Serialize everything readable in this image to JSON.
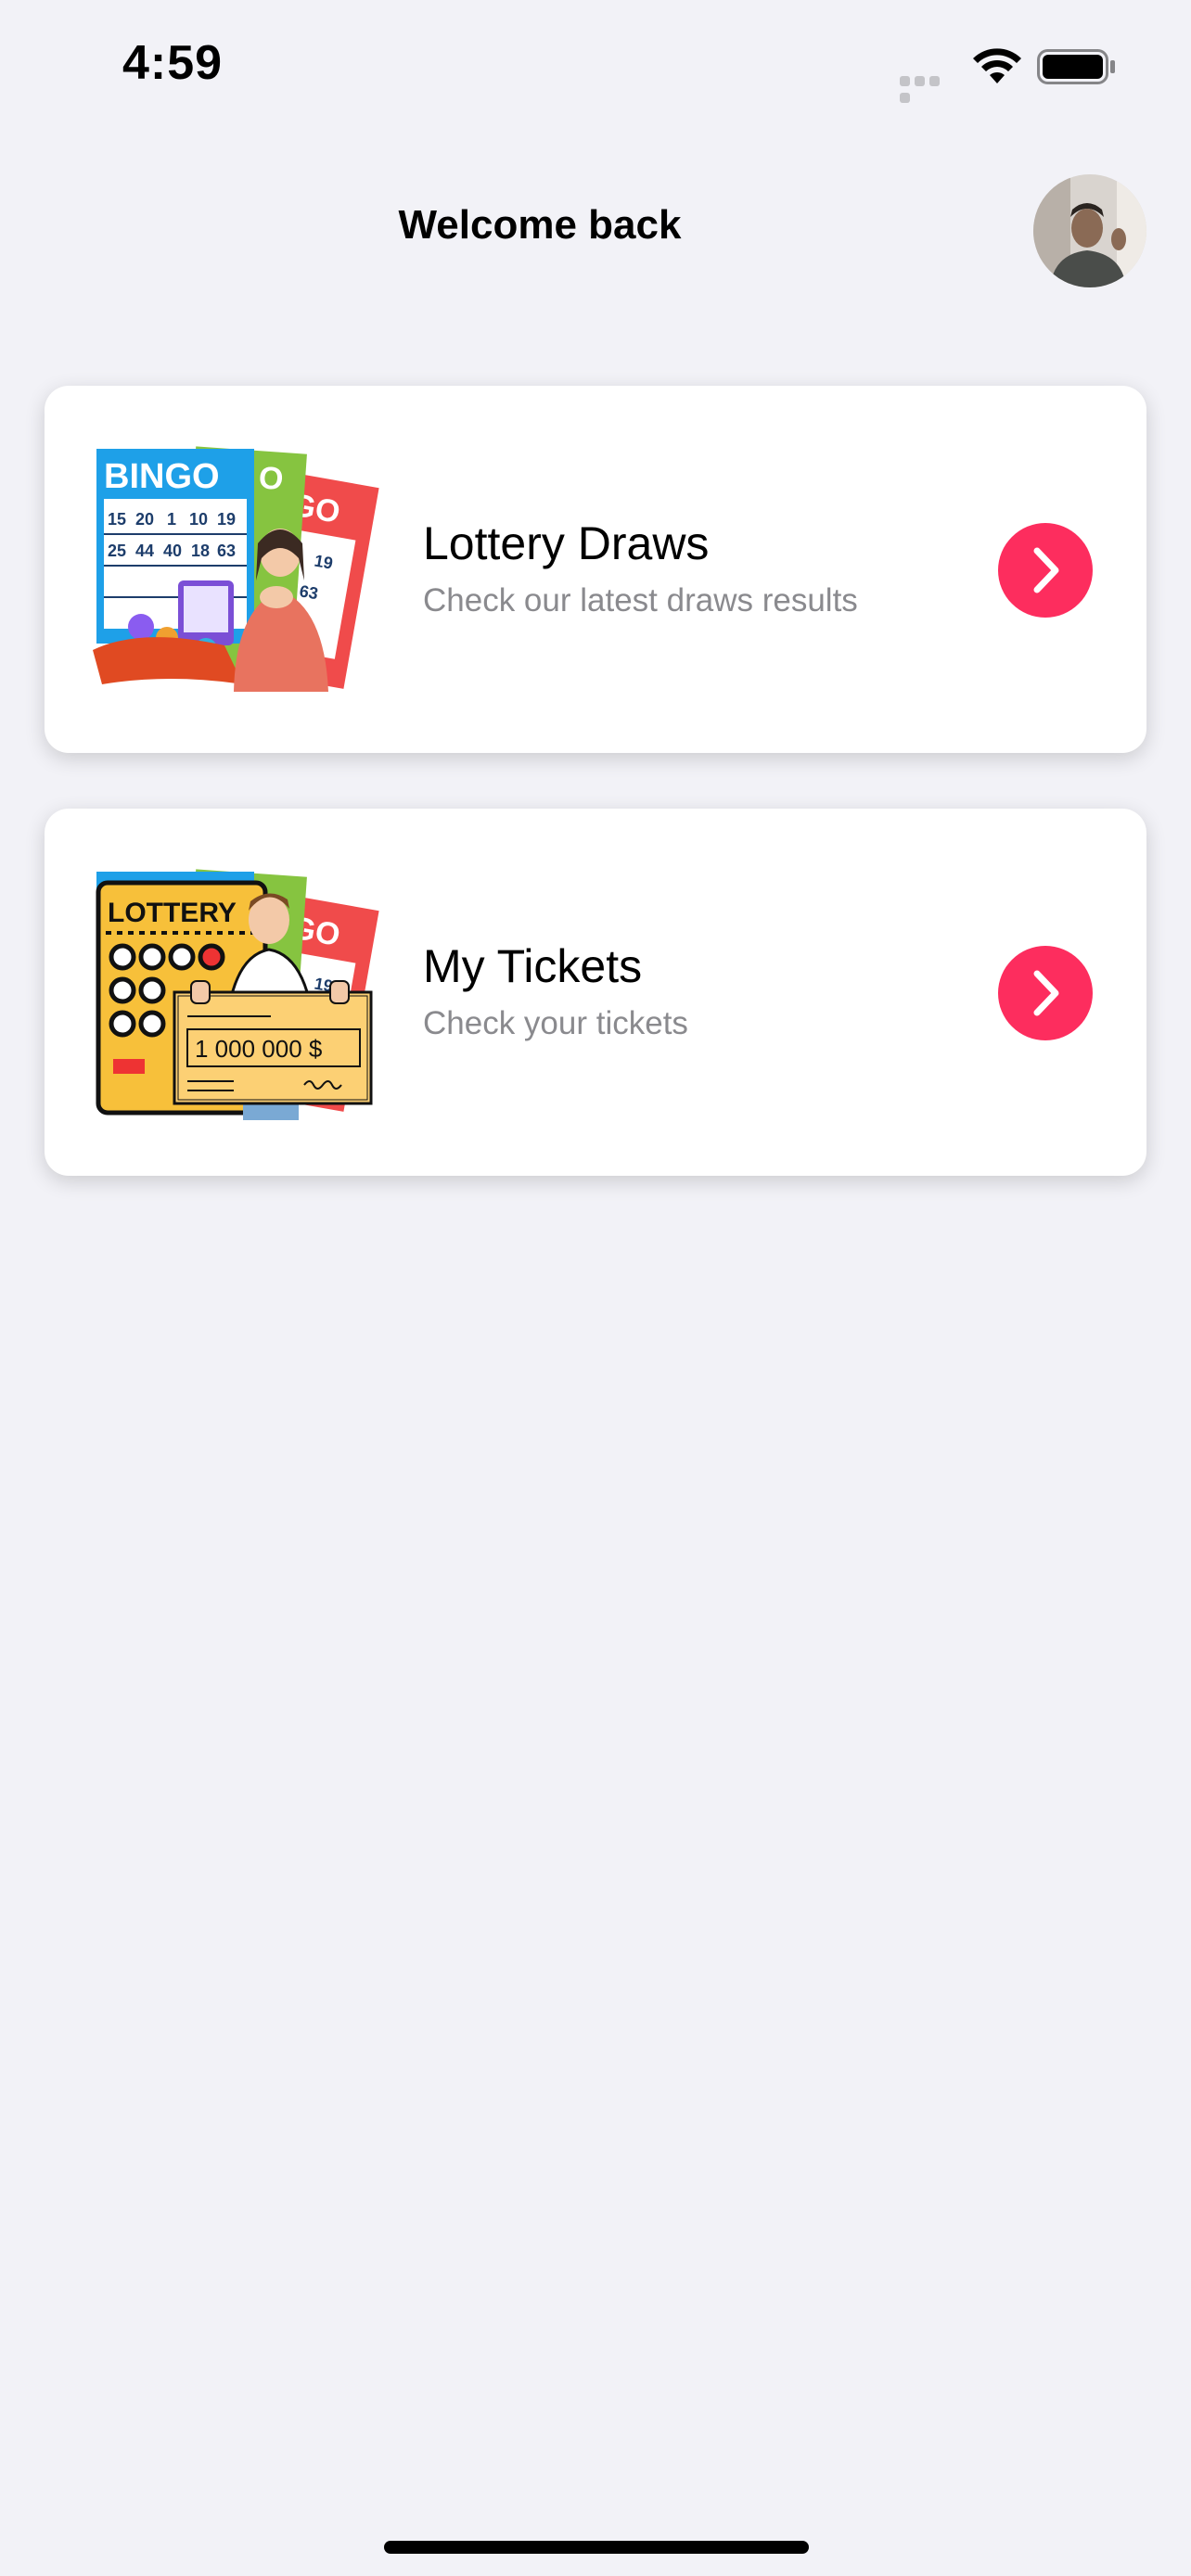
{
  "status_bar": {
    "time": "4:59",
    "signal_icon": "cellular-signal-icon",
    "wifi_icon": "wifi-icon",
    "battery_icon": "battery-full-icon"
  },
  "header": {
    "title": "Welcome back",
    "avatar_icon": "user-avatar"
  },
  "cards": [
    {
      "title": "Lottery Draws",
      "subtitle": "Check our latest draws results",
      "illustration": "bingo-cards-illustration",
      "illustration_text": [
        "BINGO",
        "GO",
        "O",
        "15",
        "20",
        "1",
        "10",
        "19",
        "25",
        "44",
        "40",
        "18",
        "63",
        "19",
        "63"
      ],
      "action_icon": "chevron-right-icon"
    },
    {
      "title": "My Tickets",
      "subtitle": "Check your tickets",
      "illustration": "lottery-winner-check-illustration",
      "illustration_text": [
        "LOTTERY",
        "GO",
        "19",
        "1 000 000 $"
      ],
      "action_icon": "chevron-right-icon"
    }
  ],
  "colors": {
    "background": "#f2f2f7",
    "card_background": "#ffffff",
    "accent": "#fd2d5e",
    "subtitle": "#8a8a8e"
  }
}
